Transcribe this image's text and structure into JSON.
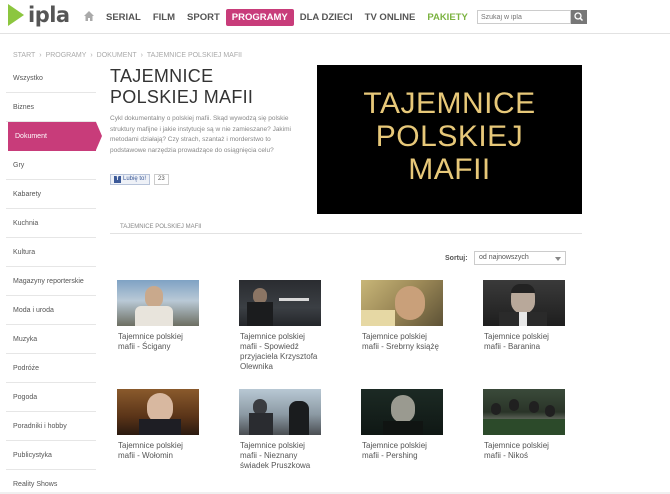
{
  "logo": {
    "text": "ipla"
  },
  "nav": {
    "items": [
      {
        "label": "SERIAL",
        "active": false
      },
      {
        "label": "FILM",
        "active": false
      },
      {
        "label": "SPORT",
        "active": false
      },
      {
        "label": "PROGRAMY",
        "active": true
      },
      {
        "label": "DLA DZIECI",
        "active": false
      },
      {
        "label": "TV ONLINE",
        "active": false
      },
      {
        "label": "PAKIETY",
        "active": false,
        "color": "#7cb342"
      }
    ]
  },
  "search": {
    "placeholder": "Szukaj w ipla"
  },
  "breadcrumb": [
    "START",
    "PROGRAMY",
    "DOKUMENT",
    "TAJEMNICE POLSKIEJ MAFII"
  ],
  "sidebar": {
    "items": [
      {
        "label": "Wszystko"
      },
      {
        "label": "Biznes"
      },
      {
        "label": "Dokument",
        "active": true
      },
      {
        "label": "Gry"
      },
      {
        "label": "Kabarety"
      },
      {
        "label": "Kuchnia"
      },
      {
        "label": "Kultura"
      },
      {
        "label": "Magazyny reporterskie"
      },
      {
        "label": "Moda i uroda"
      },
      {
        "label": "Muzyka"
      },
      {
        "label": "Podróże"
      },
      {
        "label": "Pogoda"
      },
      {
        "label": "Poradniki i hobby"
      },
      {
        "label": "Publicystyka"
      },
      {
        "label": "Reality Shows"
      }
    ]
  },
  "program": {
    "title_line1": "TAJEMNICE",
    "title_line2": "POLSKIEJ MAFII",
    "description": "Cykl dokumentalny o polskiej mafii. Skąd wywodzą się polskie struktury mafijne i jakie instytucje są w nie zamieszane? Jakimi metodami działają? Czy strach, szantaż i morderstwo to podstawowe narzędzia prowadzące do osiągnięcia celu?",
    "like_label": "Lubię to!",
    "like_count": "23",
    "hero_line1": "TAJEMNICE",
    "hero_line2": "POLSKIEJ",
    "hero_line3": "MAFII"
  },
  "section": {
    "label": "TAJEMNICE POLSKIEJ MAFII"
  },
  "sort": {
    "label": "Sortuj:",
    "value": "od najnowszych"
  },
  "videos": [
    {
      "title": "Tajemnice polskiej mafii - Ścigany"
    },
    {
      "title": "Tajemnice polskiej mafii - Spowiedź przyjaciela Krzysztofa Olewnika"
    },
    {
      "title": "Tajemnice polskiej mafii - Srebrny książę"
    },
    {
      "title": "Tajemnice polskiej mafii - Baranina"
    },
    {
      "title": "Tajemnice polskiej mafii - Wołomin"
    },
    {
      "title": "Tajemnice polskiej mafii - Nieznany świadek Pruszkowa"
    },
    {
      "title": "Tajemnice polskiej mafii - Pershing"
    },
    {
      "title": "Tajemnice polskiej mafii - Nikoś"
    }
  ],
  "colors": {
    "accent": "#c83c7a",
    "green": "#8cc63f",
    "hero_text": "#e7c879"
  }
}
